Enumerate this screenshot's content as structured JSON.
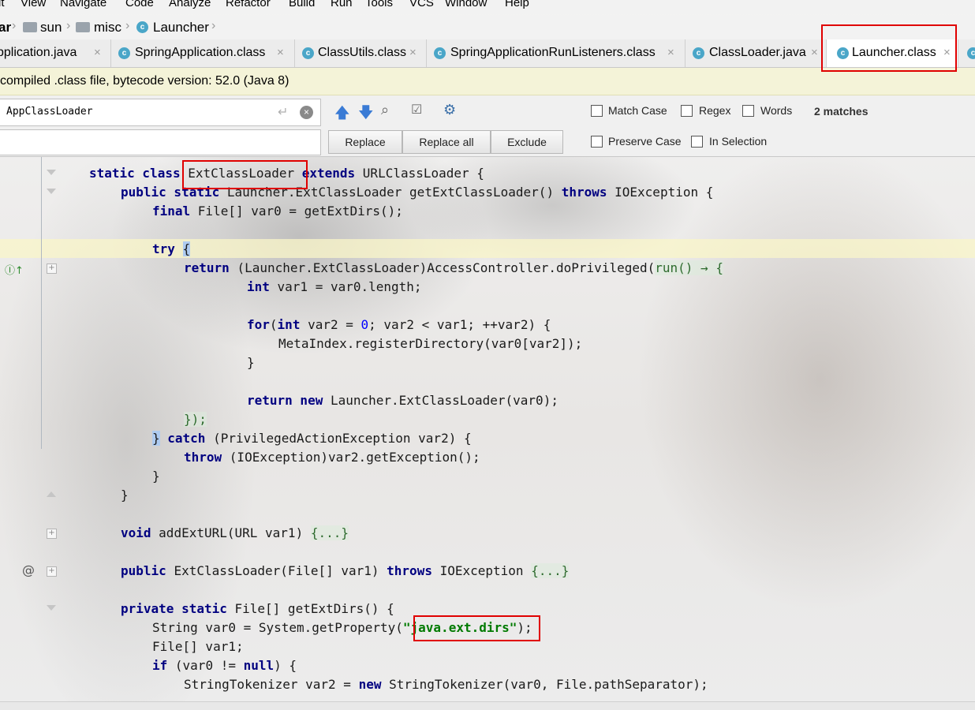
{
  "menu": [
    "it",
    "View",
    "Navigate",
    "Code",
    "Analyze",
    "Refactor",
    "Build",
    "Run",
    "Tools",
    "VCS",
    "Window",
    "Help"
  ],
  "breadcrumb": [
    "ar",
    "sun",
    "misc",
    "Launcher"
  ],
  "tabs": [
    {
      "label": "pplication.java",
      "icon": "class-icon",
      "active": false
    },
    {
      "label": "SpringApplication.class",
      "icon": "class-icon",
      "active": false
    },
    {
      "label": "ClassUtils.class",
      "icon": "class-icon",
      "active": false
    },
    {
      "label": "SpringApplicationRunListeners.class",
      "icon": "class-icon",
      "active": false
    },
    {
      "label": "ClassLoader.java",
      "icon": "class-icon",
      "active": false
    },
    {
      "label": "Launcher.class",
      "icon": "class-icon",
      "active": true
    }
  ],
  "notice": "compiled .class file, bytecode version: 52.0 (Java 8)",
  "find": {
    "query": "AppClassLoader",
    "matches": "2 matches",
    "buttons": {
      "replace": "Replace",
      "replace_all": "Replace all",
      "exclude": "Exclude"
    },
    "options": {
      "match_case": "Match Case",
      "regex": "Regex",
      "words": "Words",
      "preserve_case": "Preserve Case",
      "in_selection": "In Selection"
    }
  },
  "code": {
    "l1": {
      "a": "static class ",
      "b": "ExtClassLoader",
      "c": " extends ",
      "d": "URLClassLoader {"
    },
    "l2": {
      "a": "public static ",
      "b": "Launcher.ExtClassLoader getExtClassLoader() ",
      "c": "throws ",
      "d": "IOException {"
    },
    "l3": {
      "a": "final ",
      "b": "File[] var0 = getExtDirs();"
    },
    "l5": {
      "a": "try ",
      "b": "{"
    },
    "l6": {
      "a": "return ",
      "b": "(Launcher.ExtClassLoader)AccessController.doPrivileged(",
      "c": "run() → {"
    },
    "l7": {
      "a": "int ",
      "b": "var1 = var0.length;"
    },
    "l9": {
      "a": "for",
      "b": "(",
      "c": "int ",
      "d": "var2 = ",
      "e": "0",
      "f": "; var2 < var1; ++var2) {"
    },
    "l10": "MetaIndex.registerDirectory(var0[var2]);",
    "l11": "}",
    "l13": {
      "a": "return new ",
      "b": "Launcher.ExtClassLoader(var0);"
    },
    "l14": "});",
    "l15": {
      "a": "}",
      "b": " catch ",
      "c": "(PrivilegedActionException var2) {"
    },
    "l16": {
      "a": "throw ",
      "b": "(IOException)var2.getException();"
    },
    "l17": "}",
    "l18": "}",
    "l20": {
      "a": "void ",
      "b": "addExtURL(URL var1) ",
      "c": "{...}"
    },
    "l22": {
      "a": "public ",
      "b": "ExtClassLoader(File[] var1) ",
      "c": "throws ",
      "d": "IOException ",
      "e": "{...}"
    },
    "l24": {
      "a": "private static ",
      "b": "File[] getExtDirs() {"
    },
    "l25": {
      "a": "String var0 = System.getProperty(",
      "b": "\"java.ext.dirs\"",
      "c": ");"
    },
    "l26": "File[] var1;",
    "l27": {
      "a": "if ",
      "b": "(var0 != ",
      "c": "null",
      "d": ") {"
    },
    "l28": {
      "a": "StringTokenizer var2 = ",
      "b": "new ",
      "c": "StringTokenizer(var0, File.pathSeparator);"
    }
  },
  "gutter": {
    "at_symbol": "@"
  },
  "colors": {
    "highlight_box": "#e00000",
    "keyword": "#000080",
    "string": "#007a00",
    "notice_bg": "#f4f3d8"
  }
}
